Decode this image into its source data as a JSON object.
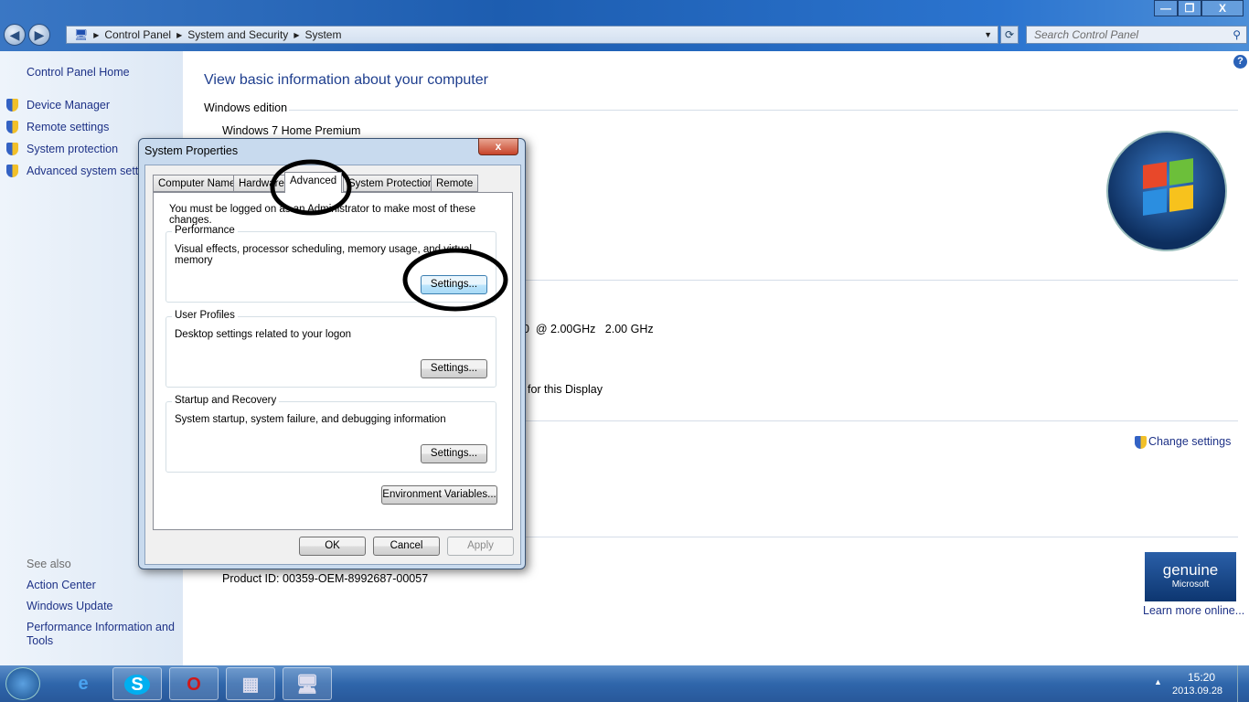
{
  "window": {
    "breadcrumb": [
      "Control Panel",
      "System and Security",
      "System"
    ],
    "search_placeholder": "Search Control Panel",
    "minimize": "—",
    "restore": "❐",
    "close": "X",
    "help": "?"
  },
  "sidebar": {
    "home": "Control Panel Home",
    "items": [
      "Device Manager",
      "Remote settings",
      "System protection",
      "Advanced system settings"
    ],
    "see_also": "See also",
    "see_also_items": [
      "Action Center",
      "Windows Update",
      "Performance Information and Tools"
    ]
  },
  "main": {
    "heading": "View basic information about your computer",
    "edition_label": "Windows edition",
    "edition": "Windows 7 Home Premium",
    "processor_speed": "0  @ 2.00GHz   2.00 GHz",
    "display_text": "for this Display",
    "change_settings": "Change settings",
    "product_id": "Product ID: 00359-OEM-8992687-00057",
    "genuine_logo": "ask for genuine Microsoft software",
    "learn_more": "Learn more online..."
  },
  "dialog": {
    "title": "System Properties",
    "close": "x",
    "tabs": [
      "Computer Name",
      "Hardware",
      "Advanced",
      "System Protection",
      "Remote"
    ],
    "active_tab": "Advanced",
    "notice": "You must be logged on as an Administrator to make most of these changes.",
    "groups": [
      {
        "label": "Performance",
        "desc": "Visual effects, processor scheduling, memory usage, and virtual memory",
        "button": "Settings..."
      },
      {
        "label": "User Profiles",
        "desc": "Desktop settings related to your logon",
        "button": "Settings..."
      },
      {
        "label": "Startup and Recovery",
        "desc": "System startup, system failure, and debugging information",
        "button": "Settings..."
      }
    ],
    "env_button": "Environment Variables...",
    "ok": "OK",
    "cancel": "Cancel",
    "apply": "Apply"
  },
  "taskbar": {
    "time": "15:20",
    "date": "2013.09.28",
    "apps": [
      "internet-explorer",
      "skype",
      "opera",
      "control-panel",
      "system-properties"
    ]
  }
}
